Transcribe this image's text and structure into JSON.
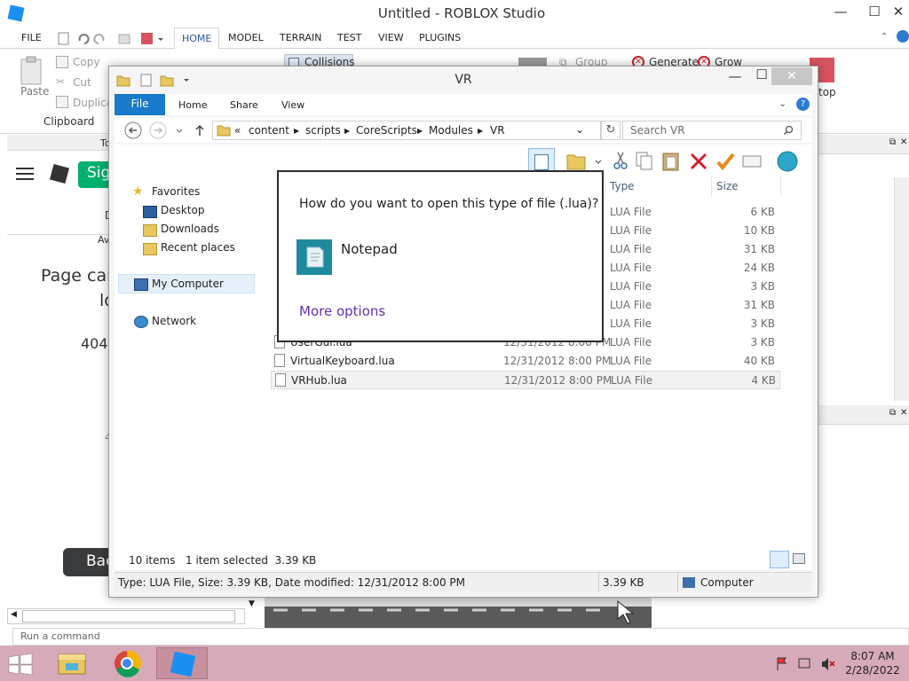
{
  "studio": {
    "title": "Untitled - ROBLOX Studio",
    "window_controls": {
      "minimize": "—",
      "maximize": "☐",
      "close": "✕"
    },
    "ribbon_tabs": [
      "FILE",
      "HOME",
      "MODEL",
      "TERRAIN",
      "TEST",
      "VIEW",
      "PLUGINS"
    ],
    "active_tab": "HOME",
    "clipboard": {
      "paste": "Paste",
      "copy": "Copy",
      "cut": "Cut",
      "duplicate": "Duplicat",
      "group_label": "Clipboard"
    },
    "collisions": "Collisions",
    "group": "Group",
    "generate": "Generate",
    "grow": "Grow",
    "top_partial": "top"
  },
  "web_panel": {
    "partial_tab": "To",
    "sign_partial": "Sig",
    "d_partial": "D",
    "av_partial": "Av",
    "page_line1": "Page car",
    "page_line2": "lo",
    "error_code": "404",
    "four_partial": "4",
    "back_partial": "Bac"
  },
  "command_bar": {
    "placeholder": "Run a command"
  },
  "explorer": {
    "title": "VR",
    "ribbon_tabs": {
      "file": "File",
      "home": "Home",
      "share": "Share",
      "view": "View"
    },
    "breadcrumb_prefix": "«",
    "breadcrumb": [
      "content",
      "scripts",
      "CoreScripts",
      "Modules",
      "VR"
    ],
    "search_placeholder": "Search VR",
    "nav": {
      "favorites": "Favorites",
      "desktop": "Desktop",
      "downloads": "Downloads",
      "recent": "Recent places",
      "my_computer": "My Computer",
      "network": "Network"
    },
    "columns": {
      "type": "Type",
      "size": "Size"
    },
    "files": [
      {
        "name": "",
        "date": "",
        "type": "LUA File",
        "size": "6 KB"
      },
      {
        "name": "",
        "date": "",
        "type": "LUA File",
        "size": "10 KB"
      },
      {
        "name": "",
        "date": "",
        "type": "LUA File",
        "size": "31 KB"
      },
      {
        "name": "",
        "date": "",
        "type": "LUA File",
        "size": "24 KB"
      },
      {
        "name": "",
        "date": "",
        "type": "LUA File",
        "size": "3 KB"
      },
      {
        "name": "",
        "date": "",
        "type": "LUA File",
        "size": "31 KB"
      },
      {
        "name": "",
        "date": "",
        "type": "LUA File",
        "size": "3 KB"
      },
      {
        "name": "UserGui.lua",
        "date": "12/31/2012 8:00 PM",
        "type": "LUA File",
        "size": "3 KB"
      },
      {
        "name": "VirtualKeyboard.lua",
        "date": "12/31/2012 8:00 PM",
        "type": "LUA File",
        "size": "40 KB"
      },
      {
        "name": "VRHub.lua",
        "date": "12/31/2012 8:00 PM",
        "type": "LUA File",
        "size": "4 KB"
      }
    ],
    "footer": {
      "count": "10 items",
      "selected": "1 item selected  3.39 KB"
    },
    "status": {
      "details": "Type: LUA File, Size: 3.39 KB, Date modified: 12/31/2012 8:00 PM",
      "size": "3.39 KB",
      "location": "Computer"
    }
  },
  "open_with": {
    "question": "How do you want to open this type of file (.lua)?",
    "app_name": "Notepad",
    "more_options": "More options"
  },
  "taskbar": {
    "time": "8:07 AM",
    "date": "2/28/2022"
  }
}
